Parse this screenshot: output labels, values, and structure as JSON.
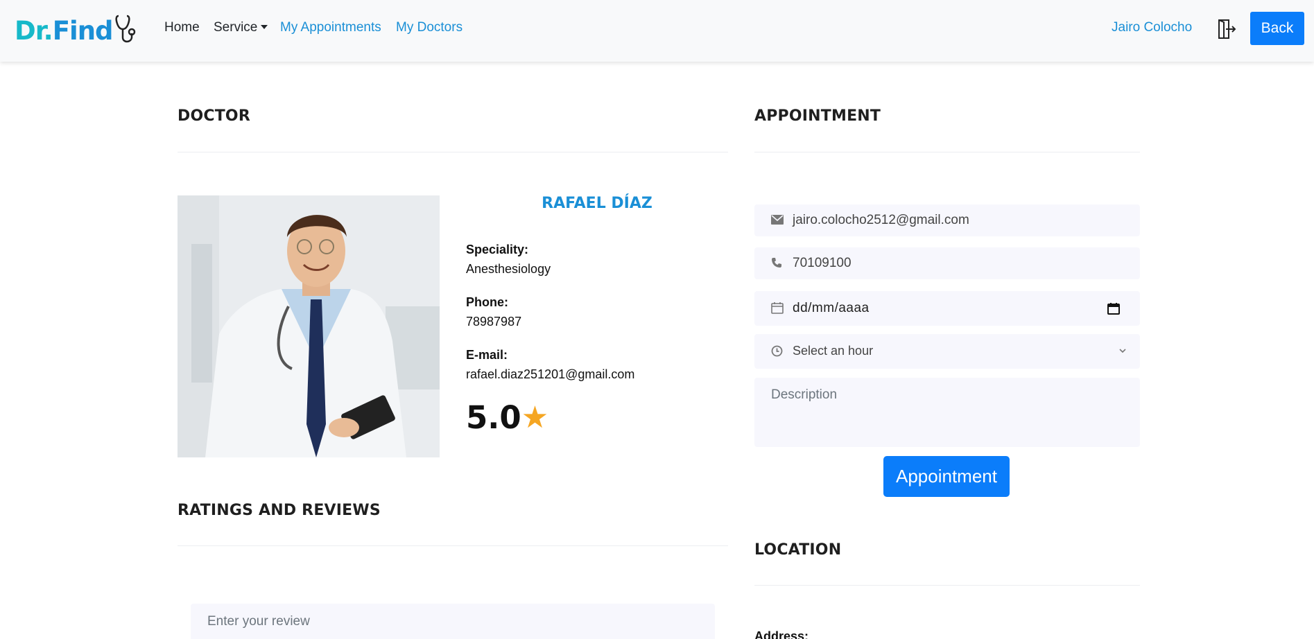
{
  "navbar": {
    "logo_part1": "Dr.",
    "logo_part2": "Find",
    "links": {
      "home": "Home",
      "service": "Service",
      "appointments": "My Appointments",
      "doctors": "My Doctors"
    },
    "user_name": "Jairo Colocho",
    "back_label": "Back"
  },
  "doctor_section": {
    "title": "DOCTOR",
    "name": "RAFAEL DÍAZ",
    "speciality_label": "Speciality:",
    "speciality": "Anesthesiology",
    "phone_label": "Phone:",
    "phone": "78987987",
    "email_label": "E-mail:",
    "email": "rafael.diaz251201@gmail.com",
    "rating": "5.0",
    "rating_star": "★"
  },
  "appointment_section": {
    "title": "APPOINTMENT",
    "email_value": "jairo.colocho2512@gmail.com",
    "phone_value": "70109100",
    "date_placeholder": "dd/mm/aaaa",
    "hour_placeholder": "Select an hour",
    "description_placeholder": "Description",
    "submit_label": "Appointment"
  },
  "reviews_section": {
    "title": "RATINGS AND REVIEWS",
    "review_placeholder": "Enter your review"
  },
  "location_section": {
    "title": "LOCATION",
    "address_label": "Address:"
  },
  "colors": {
    "brand_teal": "#17b9c9",
    "brand_blue": "#1a8fd6",
    "primary_button": "#0b7dfa",
    "star": "#f5a623",
    "field_bg": "#f7f7fd"
  }
}
